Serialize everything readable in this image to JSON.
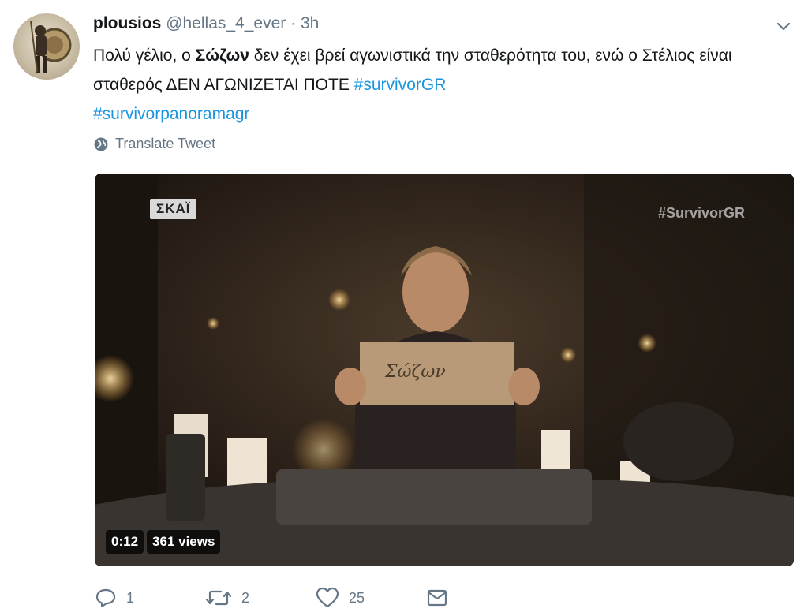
{
  "tweet": {
    "display_name": "plousios",
    "handle": "@hellas_4_ever",
    "separator": "·",
    "time": "3h",
    "text_part1": "Πολύ γέλιο, ο ",
    "text_bold": "Σώζων",
    "text_part2": " δεν έχει βρεί αγωνιστικά την σταθερότητα του, ενώ ο Στέλιος είναι σταθερός ΔΕΝ ΑΓΩΝΙΖΕΤΑΙ ΠΟΤΕ ",
    "hashtag1": "#survivorGR",
    "hashtag2": "#survivorpanoramagr",
    "translate_label": "Translate Tweet"
  },
  "video": {
    "channel_logo": "ΣΚΑΪ",
    "watermark": "#SurvivorGR",
    "sign_text": "Σώζων",
    "duration": "0:12",
    "views": "361 views"
  },
  "actions": {
    "reply_count": "1",
    "retweet_count": "2",
    "like_count": "25"
  },
  "colors": {
    "link": "#1b95e0",
    "muted": "#657786",
    "text": "#14171a"
  }
}
